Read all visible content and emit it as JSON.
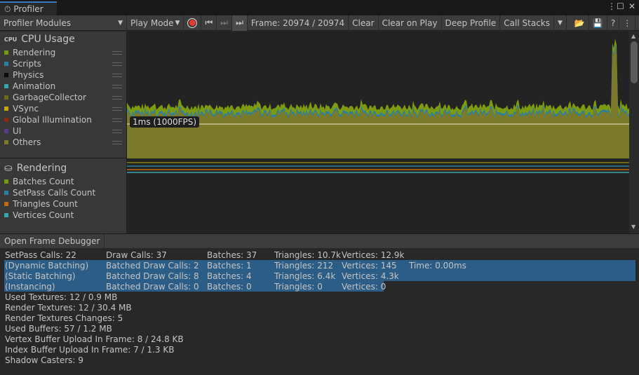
{
  "window": {
    "tab_title": "Profiler"
  },
  "toolbar": {
    "modules": "Profiler Modules",
    "play_mode": "Play Mode",
    "frame": "Frame: 20974 / 20974",
    "clear": "Clear",
    "clear_on_play": "Clear on Play",
    "deep_profile": "Deep Profile",
    "call_stacks": "Call Stacks"
  },
  "cpu": {
    "title": "CPU Usage",
    "tooltip": "1ms (1000FPS)",
    "items": [
      {
        "label": "Rendering",
        "color": "#6f9a11"
      },
      {
        "label": "Scripts",
        "color": "#2a7fa4"
      },
      {
        "label": "Physics",
        "color": "#0a0a0a"
      },
      {
        "label": "Animation",
        "color": "#3aa4b0"
      },
      {
        "label": "GarbageCollector",
        "color": "#6a6a14"
      },
      {
        "label": "VSync",
        "color": "#c6a115"
      },
      {
        "label": "Global Illumination",
        "color": "#8e2a10"
      },
      {
        "label": "UI",
        "color": "#5a3a8a"
      },
      {
        "label": "Others",
        "color": "#7a7a2a"
      }
    ]
  },
  "rendering": {
    "title": "Rendering",
    "items": [
      {
        "label": "Batches Count",
        "color": "#6f9a11"
      },
      {
        "label": "SetPass Calls Count",
        "color": "#2a7fa4"
      },
      {
        "label": "Triangles Count",
        "color": "#c06a10"
      },
      {
        "label": "Vertices Count",
        "color": "#3aa4b0"
      }
    ]
  },
  "details": {
    "open_frame_debugger": "Open Frame Debugger",
    "rows": [
      [
        "SetPass Calls: 22",
        "Draw Calls: 37",
        "Batches: 37",
        "Triangles: 10.7k",
        "Vertices: 12.9k",
        ""
      ],
      [
        "(Dynamic Batching)",
        "Batched Draw Calls: 2",
        "Batches: 1",
        "Triangles: 212",
        "Vertices: 145",
        "Time: 0.00ms"
      ],
      [
        "(Static Batching)",
        "Batched Draw Calls: 8",
        "Batches: 4",
        "Triangles: 6.4k",
        "Vertices: 4.3k",
        ""
      ],
      [
        "(Instancing)",
        "Batched Draw Calls: 0",
        "Batches: 0",
        "Triangles: 0",
        "Vertices: 0",
        ""
      ]
    ],
    "lines": [
      "Used Textures: 12 / 0.9 MB",
      "Render Textures: 12 / 30.4 MB",
      "Render Textures Changes: 5",
      "Used Buffers: 57 / 1.2 MB",
      "Vertex Buffer Upload In Frame: 8 / 24.8 KB",
      "Index Buffer Upload In Frame: 7 / 1.3 KB",
      "Shadow Casters: 9"
    ]
  }
}
